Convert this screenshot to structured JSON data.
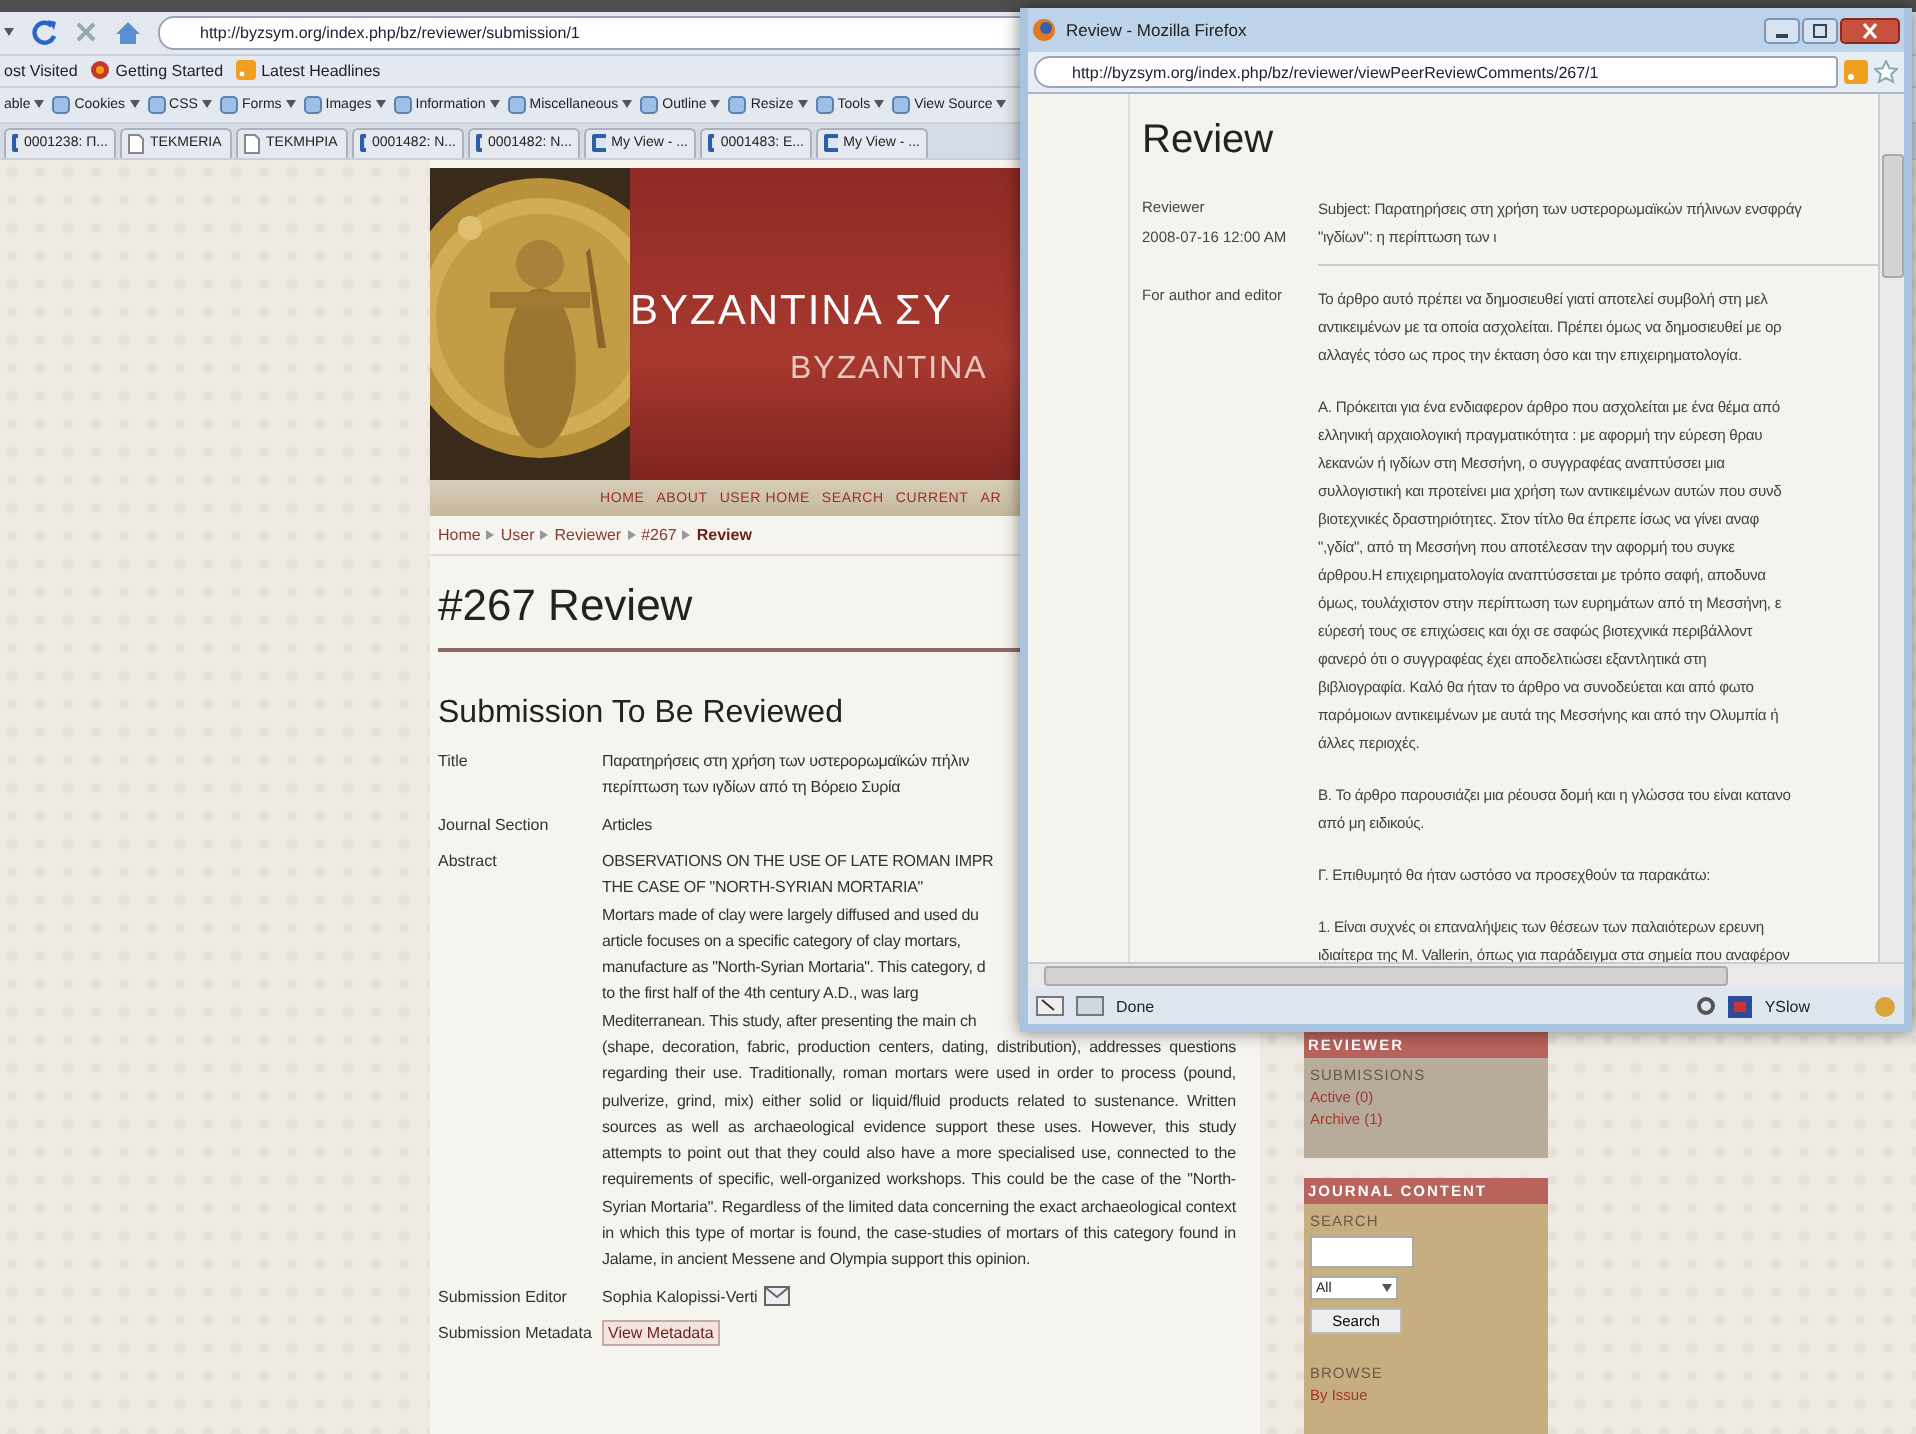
{
  "browser": {
    "url": "http://byzsym.org/index.php/bz/reviewer/submission/1",
    "bookmarks": [
      {
        "label": "ost Visited",
        "kind": "plain"
      },
      {
        "label": "Getting Started",
        "kind": "start"
      },
      {
        "label": "Latest Headlines",
        "kind": "feed"
      }
    ],
    "dev_toolbar": [
      {
        "label": "able",
        "has_icon": false
      },
      {
        "label": "Cookies",
        "has_icon": true
      },
      {
        "label": "CSS",
        "has_icon": true
      },
      {
        "label": "Forms",
        "has_icon": true
      },
      {
        "label": "Images",
        "has_icon": true
      },
      {
        "label": "Information",
        "has_icon": true
      },
      {
        "label": "Miscellaneous",
        "has_icon": true
      },
      {
        "label": "Outline",
        "has_icon": true
      },
      {
        "label": "Resize",
        "has_icon": true
      },
      {
        "label": "Tools",
        "has_icon": true
      },
      {
        "label": "View Source",
        "has_icon": true
      }
    ],
    "tabs": [
      {
        "label": "0001238: Π...",
        "kind": "site"
      },
      {
        "label": "TEKMERIA",
        "kind": "page"
      },
      {
        "label": "TEKMHPIA",
        "kind": "page"
      },
      {
        "label": "0001482: N...",
        "kind": "site"
      },
      {
        "label": "0001482: N...",
        "kind": "site"
      },
      {
        "label": "My View - ...",
        "kind": "site"
      },
      {
        "label": "0001483: E...",
        "kind": "site"
      },
      {
        "label": "My View - ...",
        "kind": "site"
      }
    ]
  },
  "page": {
    "banner": {
      "title": "BYZANTINA ΣΥ",
      "subtitle": "BYZANTINA"
    },
    "nav": [
      "HOME",
      "ABOUT",
      "USER HOME",
      "SEARCH",
      "CURRENT",
      "AR"
    ],
    "breadcrumb": [
      {
        "label": "Home",
        "current": false
      },
      {
        "label": "User",
        "current": false
      },
      {
        "label": "Reviewer",
        "current": false
      },
      {
        "label": "#267",
        "current": false
      },
      {
        "label": "Review",
        "current": true
      }
    ],
    "heading": "#267 Review",
    "section_title": "Submission To Be Reviewed",
    "fields": [
      {
        "kind": "text",
        "label": "Title",
        "lines": [
          "Παρατηρήσεις στη χρήση των υστερορωμαϊκών πήλιν",
          "περίπτωση των ιγδίων από τη Βόρειο Συρία"
        ]
      },
      {
        "kind": "text",
        "label": "Journal Section",
        "lines": [
          "Articles"
        ]
      },
      {
        "kind": "text",
        "label": "Abstract",
        "lines": [
          "OBSERVATIONS ON THE USE OF LATE ROMAN IMPR",
          "THE CASE OF \"NORTH-SYRIAN MORTARIA\"",
          "Mortars made of clay were largely diffused and used du",
          "article focuses on a specific category of clay mortars,",
          "manufacture as \"North-Syrian Mortaria\". This category, d",
          "to the first half of the 4th century A.D., was larg",
          "Mediterranean. This study, after presenting the main ch"
        ],
        "text": "(shape, decoration, fabric, production centers, dating, distribution), addresses questions regarding their use. Traditionally, roman mortars were used in order to process (pound, pulverize, grind, mix) either solid or liquid/fluid products related to sustenance. Written sources as well as archaeological evidence support these uses. However, this study attempts to point out that they could also have a more specialised use, connected to the requirements of specific, well-organized workshops. This could be the case of the \"North-Syrian Mortaria\". Regardless of the limited data concerning the exact archaeological context in which this type of mortar is found, the case-studies of mortars of this category found in Jalame, in ancient Messene and Olympia support this opinion."
      },
      {
        "kind": "editor",
        "label": "Submission Editor",
        "value": "Sophia Kalopissi-Verti"
      },
      {
        "kind": "button",
        "label": "Submission Metadata",
        "value": "View Metadata"
      }
    ]
  },
  "sidebar": {
    "reviewer": {
      "title": "REVIEWER",
      "subtitle": "SUBMISSIONS",
      "links": [
        "Active (0)",
        "Archive (1)"
      ]
    },
    "journal": {
      "title": "JOURNAL CONTENT",
      "search_label": "SEARCH",
      "scope": "All",
      "search_button": "Search",
      "browse_label": "BROWSE",
      "links": [
        "By Issue"
      ]
    }
  },
  "popup": {
    "title": "Review - Mozilla Firefox",
    "url": "http://byzsym.org/index.php/bz/reviewer/viewPeerReviewComments/267/1",
    "heading": "Review",
    "reviewer_label": "Reviewer",
    "date": "2008-07-16 12:00 AM",
    "audience": "For author and editor",
    "subject": [
      "Subject: Παρατηρήσεις στη χρήση των υστερορωμαϊκών πήλινων ενσφράγ",
      "\"ιγδίων\": η περίπτωση των ι"
    ],
    "paragraphs": [
      [
        "Το άρθρο αυτό πρέπει να δημοσιευθεί γιατί αποτελεί συμβολή στη μελ",
        "αντικειμένων με τα οποία ασχολείται. Πρέπει όμως να δημοσιευθεί με ορ",
        "αλλαγές τόσο ως προς την έκταση όσο και την επιχειρηματολογία."
      ],
      [
        "Α. Πρόκειται για ένα ενδιαφερον άρθρο που ασχολείται με ένα θέμα από",
        "ελληνική αρχαιολογική πραγματικότητα : με αφορμή την εύρεση θραυ",
        "λεκανών ή ιγδίων στη Μεσσήνη, ο συγγραφέας αναπτύσσει μια",
        "συλλογιστική και προτείνει μια χρήση των αντικειμένων αυτών που συνδ",
        "βιοτεχνικές δραστηριότητες. Στον τίτλο θα έπρεπε ίσως να γίνει αναφ",
        "\",γδία\", από τη Μεσσήνη που αποτέλεσαν την αφορμή του συγκε",
        "άρθρου.Η επιχειρηματολογία αναπτύσσεται με τρόπο σαφή, αποδυνα",
        "όμως, τουλάχιστον στην περίπτωση των ευρημάτων από τη Μεσσήνη, ε",
        "εύρεσή τους σε επιχώσεις και όχι σε σαφώς βιοτεχνικά περιβάλλοντ",
        "φανερό ότι ο συγγραφέας έχει αποδελτιώσει εξαντλητικά στη",
        "βιβλιογραφία. Καλό θα ήταν το άρθρο να συνοδεύεται και από φωτο",
        "παρόμοιων αντικειμένων με αυτά της Μεσσήνης και από την Ολυμπία ή",
        "άλλες περιοχές."
      ],
      [
        "Β. Το άρθρο παρουσιάζει μια ρέουσα δομή και η γλώσσα του είναι κατανο",
        "από μη ειδικούς."
      ],
      [
        "Γ. Επιθυμητό θα ήταν ωστόσο  να προσεχθούν τα παρακάτω:"
      ],
      [
        "1. Είναι συχνές οι επαναλήψεις των θέσεων των παλαιότερων ερευνη",
        "ιδιαίτερα της M. Vallerin, όπως για παράδειγμα στα σημεία που αναφέρον"
      ]
    ],
    "status": "Done",
    "addon": "YSlow"
  }
}
